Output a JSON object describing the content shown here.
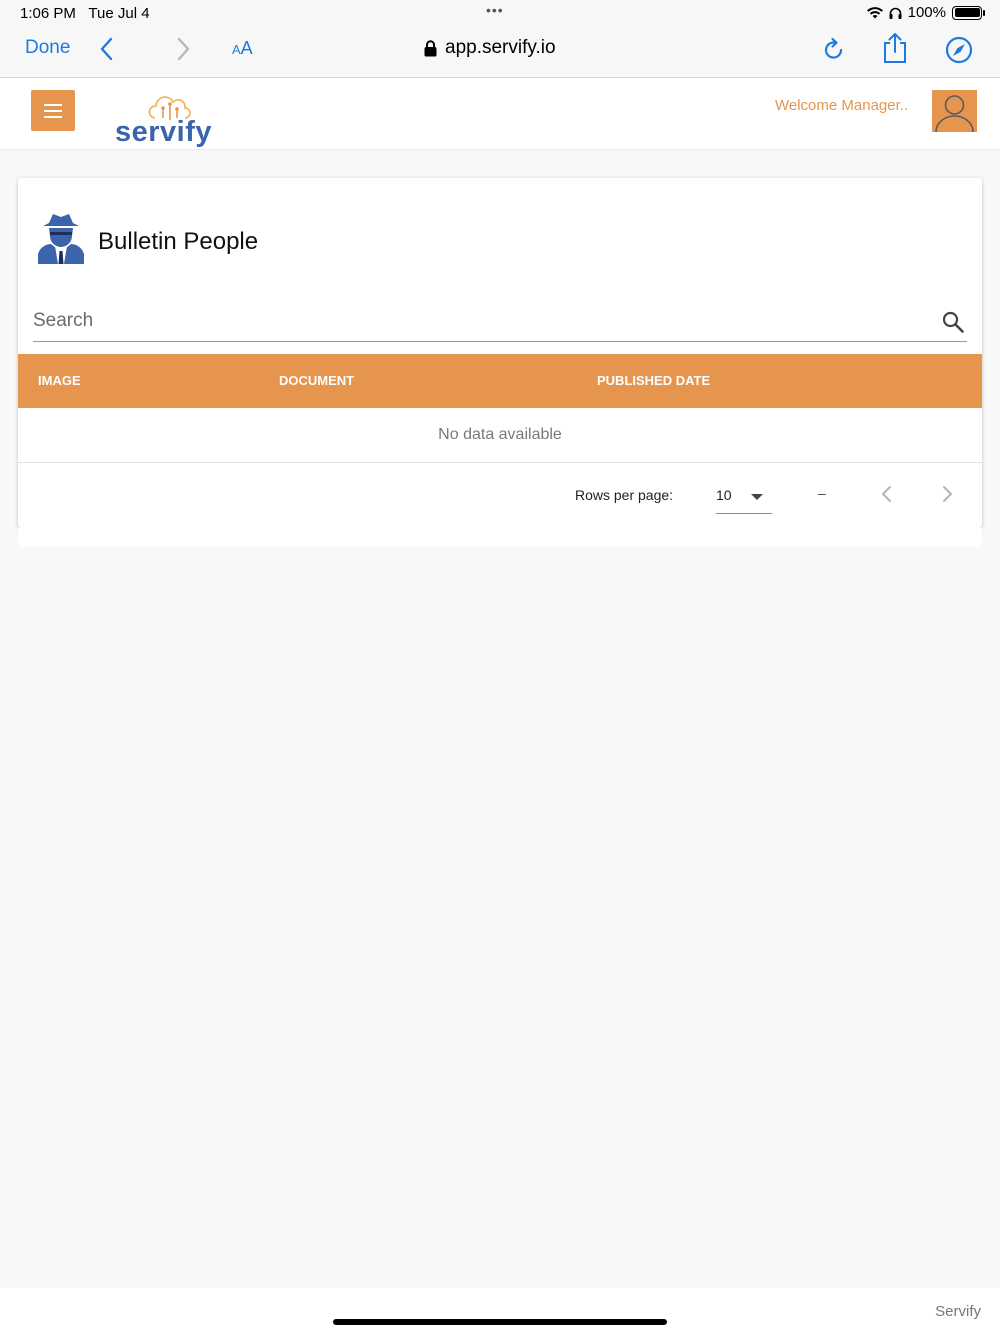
{
  "status_bar": {
    "time": "1:06 PM",
    "date": "Tue Jul 4",
    "battery": "100%"
  },
  "browser": {
    "done_label": "Done",
    "aa_label_small": "A",
    "aa_label_large": "A",
    "url": "app.servify.io"
  },
  "header": {
    "logo_text": "servify",
    "welcome": "Welcome Manager..",
    "accent_color": "#e5954e",
    "brand_color": "#3b64ac"
  },
  "card": {
    "title": "Bulletin People",
    "icon": "spy-agent-icon",
    "search": {
      "placeholder": "Search",
      "value": ""
    },
    "table": {
      "columns": [
        "IMAGE",
        "DOCUMENT",
        "PUBLISHED DATE"
      ],
      "rows": [],
      "empty_message": "No data available"
    },
    "pagination": {
      "rows_per_page_label": "Rows per page:",
      "rows_per_page_value": "10",
      "range_text": "–"
    }
  },
  "footer": {
    "brand": "Servify"
  }
}
